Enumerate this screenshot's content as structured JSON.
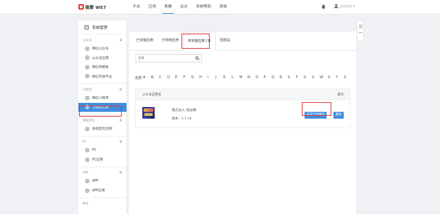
{
  "brand": {
    "logo_text": "微擎 WE7"
  },
  "nav": {
    "items": [
      "平台",
      "应用",
      "系统",
      "站点",
      "系统帮助",
      "商城"
    ],
    "active_index": 2
  },
  "sidebar": {
    "title": "系统管理",
    "groups": [
      {
        "label": "公众号",
        "items": [
          "微信公众号",
          "公众号应用",
          "微信同模板",
          "微信开放平台"
        ]
      },
      {
        "label": "小程序",
        "items": [
          "微信小程序",
          "小程序应用"
        ]
      },
      {
        "label": "系统首页",
        "items": [
          "系统首页应用"
        ]
      },
      {
        "label": "PC",
        "items": [
          "PC",
          "PC应用"
        ]
      },
      {
        "label": "APP",
        "items": [
          "APP",
          "APP应用"
        ]
      },
      {
        "label": "帐号"
      }
    ],
    "active_item": "小程序应用"
  },
  "tabs": [
    "已安装应用",
    "已停用应用",
    "未安装应用 (1)",
    "回收站"
  ],
  "active_tab_index": 2,
  "search": {
    "placeholder": "名称"
  },
  "letters": [
    "全部",
    "A",
    "B",
    "C",
    "D",
    "E",
    "F",
    "G",
    "H",
    "I",
    "J",
    "K",
    "L",
    "M",
    "N",
    "O",
    "P",
    "Q",
    "R",
    "S",
    "T",
    "U",
    "V",
    "W",
    "X",
    "Y",
    "Z"
  ],
  "table": {
    "col_name": "公众号应用名",
    "col_action": "操作",
    "rows": [
      {
        "name": "我方达人-常达网",
        "version_label": "版本",
        "version": "1.7.14",
        "install_label": "安装应用模块",
        "delete_label": "删除"
      }
    ]
  },
  "colors": {
    "accent": "#3f8ee0",
    "highlight": "#e0322b"
  }
}
